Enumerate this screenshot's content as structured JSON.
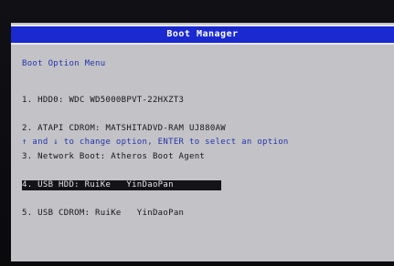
{
  "window": {
    "title": "Boot Manager"
  },
  "menu": {
    "heading": "Boot Option Menu",
    "items": [
      {
        "label": "1. HDD0: WDC WD5000BPVT-22HXZT3",
        "selected": false
      },
      {
        "label": "2. ATAPI CDROM: MATSHITADVD-RAM UJ880AW",
        "selected": false
      },
      {
        "label": "3. Network Boot: Atheros Boot Agent",
        "selected": false
      },
      {
        "label": "4. USB HDD: RuiKe   YinDaoPan",
        "selected": true
      },
      {
        "label": "5. USB CDROM: RuiKe   YinDaoPan",
        "selected": false
      }
    ]
  },
  "help": {
    "text": "↑ and ↓ to change option, ENTER to select an option"
  },
  "colors": {
    "title_bar": "#1a2ad0",
    "screen_bg": "#c3c3c7",
    "accent_text": "#2233aa",
    "selection_bg": "#141418"
  }
}
